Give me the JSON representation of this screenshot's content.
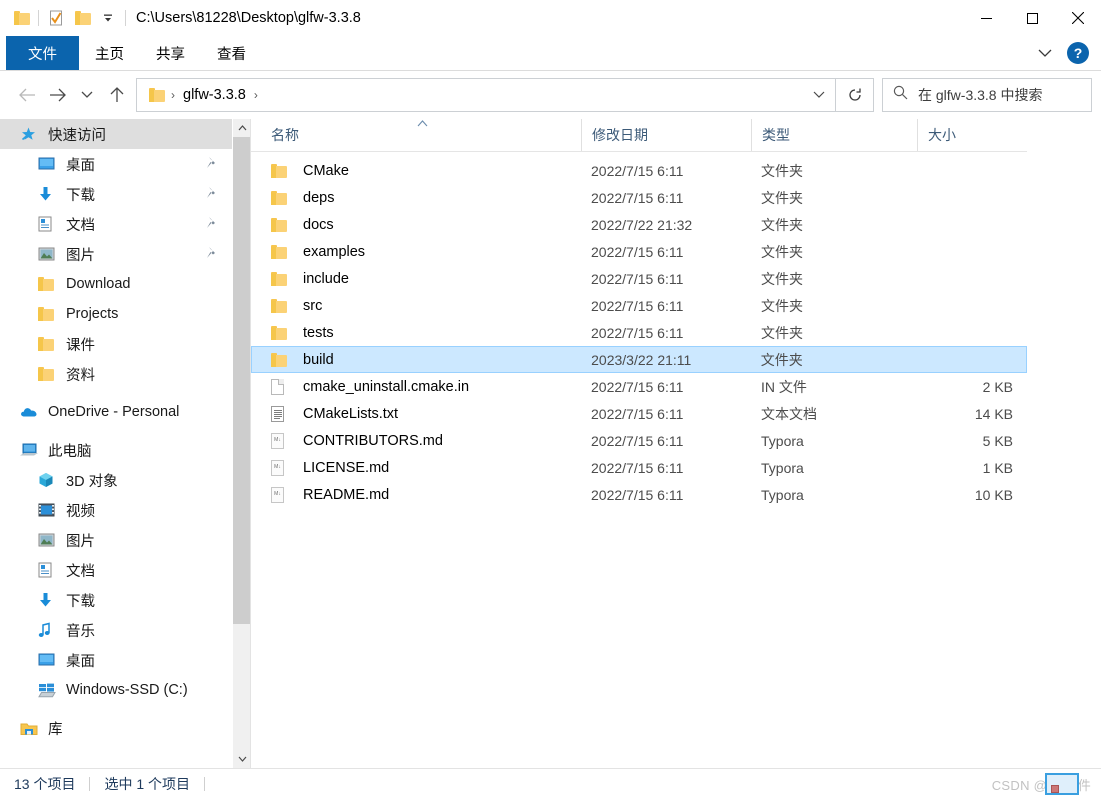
{
  "titlebar": {
    "path": "C:\\Users\\81228\\Desktop\\glfw-3.3.8",
    "qat_icons": [
      "folder-icon",
      "properties-icon",
      "new-folder-icon",
      "customize-caret-icon"
    ],
    "controls": {
      "minimize": "—",
      "maximize": "☐",
      "close": "✕"
    }
  },
  "ribbon": {
    "tabs": [
      {
        "label": "文件",
        "active": true
      },
      {
        "label": "主页",
        "active": false
      },
      {
        "label": "共享",
        "active": false
      },
      {
        "label": "查看",
        "active": false
      }
    ],
    "expand_icon": "chevron-down-icon",
    "help_label": "?",
    "accent_color": "#0b64ad"
  },
  "addressbar": {
    "back_icon": "arrow-left-icon",
    "forward_icon": "arrow-right-icon",
    "recent_icon": "chevron-down-icon",
    "up_icon": "arrow-up-icon",
    "crumbs": [
      "glfw-3.3.8"
    ],
    "crumb_sep": "›",
    "dropdown_icon": "chevron-down-icon",
    "refresh_icon": "refresh-icon",
    "refresh_glyph": "↻"
  },
  "search": {
    "icon": "search-icon",
    "placeholder": "在 glfw-3.3.8 中搜索"
  },
  "sidebar": {
    "groups": [
      {
        "header": {
          "label": "快速访问",
          "icon": "star-pin-icon",
          "selected": true
        },
        "items": [
          {
            "label": "桌面",
            "icon": "desktop-icon",
            "pinned": true
          },
          {
            "label": "下载",
            "icon": "download-icon",
            "pinned": true
          },
          {
            "label": "文档",
            "icon": "documents-icon",
            "pinned": true
          },
          {
            "label": "图片",
            "icon": "pictures-icon",
            "pinned": true
          },
          {
            "label": "Download",
            "icon": "folder-icon",
            "pinned": false
          },
          {
            "label": "Projects",
            "icon": "folder-icon",
            "pinned": false
          },
          {
            "label": "课件",
            "icon": "folder-icon",
            "pinned": false
          },
          {
            "label": "资料",
            "icon": "folder-icon",
            "pinned": false
          }
        ]
      },
      {
        "header": {
          "label": "OneDrive - Personal",
          "icon": "onedrive-icon",
          "selected": false
        },
        "items": []
      },
      {
        "header": {
          "label": "此电脑",
          "icon": "this-pc-icon",
          "selected": false
        },
        "items": [
          {
            "label": "3D 对象",
            "icon": "3d-objects-icon",
            "pinned": false
          },
          {
            "label": "视频",
            "icon": "videos-icon",
            "pinned": false
          },
          {
            "label": "图片",
            "icon": "pictures-icon",
            "pinned": false
          },
          {
            "label": "文档",
            "icon": "documents-icon",
            "pinned": false
          },
          {
            "label": "下载",
            "icon": "download-icon",
            "pinned": false
          },
          {
            "label": "音乐",
            "icon": "music-icon",
            "pinned": false
          },
          {
            "label": "桌面",
            "icon": "desktop-icon",
            "pinned": false
          },
          {
            "label": "Windows-SSD (C:)",
            "icon": "drive-icon",
            "pinned": false
          }
        ]
      },
      {
        "header": {
          "label": "库",
          "icon": "library-icon",
          "selected": false
        },
        "items": []
      }
    ],
    "scroll_up_icon": "chevron-up-icon",
    "scroll_down_icon": "chevron-down-icon"
  },
  "filelist": {
    "columns": [
      {
        "label": "名称",
        "sorted": true,
        "sort_glyph": "˄"
      },
      {
        "label": "修改日期",
        "sorted": false
      },
      {
        "label": "类型",
        "sorted": false
      },
      {
        "label": "大小",
        "sorted": false
      }
    ],
    "selection_bg": "#cce8ff",
    "rows": [
      {
        "name": "CMake",
        "date": "2022/7/15 6:11",
        "type": "文件夹",
        "size": "",
        "icon": "folder-icon",
        "selected": false
      },
      {
        "name": "deps",
        "date": "2022/7/15 6:11",
        "type": "文件夹",
        "size": "",
        "icon": "folder-icon",
        "selected": false
      },
      {
        "name": "docs",
        "date": "2022/7/22 21:32",
        "type": "文件夹",
        "size": "",
        "icon": "folder-icon",
        "selected": false
      },
      {
        "name": "examples",
        "date": "2022/7/15 6:11",
        "type": "文件夹",
        "size": "",
        "icon": "folder-icon",
        "selected": false
      },
      {
        "name": "include",
        "date": "2022/7/15 6:11",
        "type": "文件夹",
        "size": "",
        "icon": "folder-icon",
        "selected": false
      },
      {
        "name": "src",
        "date": "2022/7/15 6:11",
        "type": "文件夹",
        "size": "",
        "icon": "folder-icon",
        "selected": false
      },
      {
        "name": "tests",
        "date": "2022/7/15 6:11",
        "type": "文件夹",
        "size": "",
        "icon": "folder-icon",
        "selected": false
      },
      {
        "name": "build",
        "date": "2023/3/22 21:11",
        "type": "文件夹",
        "size": "",
        "icon": "folder-icon",
        "selected": true
      },
      {
        "name": "cmake_uninstall.cmake.in",
        "date": "2022/7/15 6:11",
        "type": "IN 文件",
        "size": "2 KB",
        "icon": "blank-file-icon",
        "selected": false
      },
      {
        "name": "CMakeLists.txt",
        "date": "2022/7/15 6:11",
        "type": "文本文档",
        "size": "14 KB",
        "icon": "text-file-icon",
        "selected": false
      },
      {
        "name": "CONTRIBUTORS.md",
        "date": "2022/7/15 6:11",
        "type": "Typora",
        "size": "5 KB",
        "icon": "markdown-file-icon",
        "selected": false
      },
      {
        "name": "LICENSE.md",
        "date": "2022/7/15 6:11",
        "type": "Typora",
        "size": "1 KB",
        "icon": "markdown-file-icon",
        "selected": false
      },
      {
        "name": "README.md",
        "date": "2022/7/15 6:11",
        "type": "Typora",
        "size": "10 KB",
        "icon": "markdown-file-icon",
        "selected": false
      }
    ]
  },
  "statusbar": {
    "item_count": "13 个项目",
    "selection": "选中 1 个项目",
    "watermark": "CSDN @Ue软件"
  }
}
